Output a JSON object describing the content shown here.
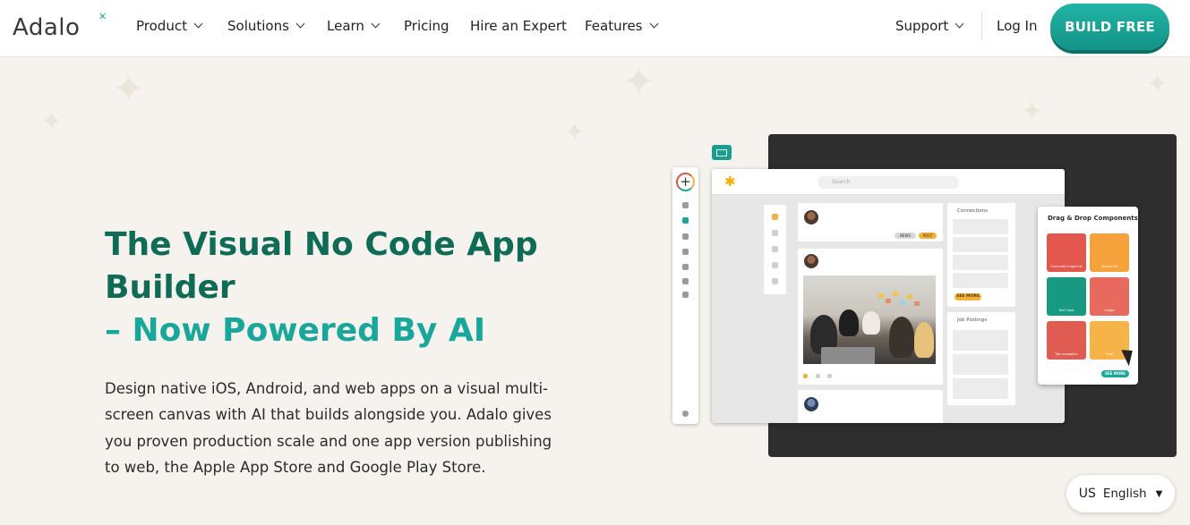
{
  "nav": {
    "logo": "Adalo",
    "items": [
      {
        "label": "Product",
        "dropdown": true
      },
      {
        "label": "Solutions",
        "dropdown": true
      },
      {
        "label": "Learn",
        "dropdown": true
      },
      {
        "label": "Pricing",
        "dropdown": false
      },
      {
        "label": "Hire an Expert",
        "dropdown": false
      },
      {
        "label": "Features",
        "dropdown": true
      }
    ],
    "support": "Support",
    "login": "Log In",
    "cta": "BUILD FREE"
  },
  "hero": {
    "headline_1": "The Visual No Code App Builder",
    "headline_2": "– Now Powered By AI",
    "description": "Design native iOS, Android, and web apps on a visual multi-screen canvas with AI that builds alongside you. Adalo gives you proven production scale and one app version publishing to web, the Apple App Store and Google Play Store."
  },
  "mockup": {
    "search_placeholder": "Search",
    "pill_gray": "NEWS",
    "pill_yellow": "POST",
    "connections_label": "Connections",
    "see_more": "SEE MORE",
    "job_postings_label": "Job Postings",
    "dnd_title": "Drag & Drop Components",
    "dnd_see_more": "SEE MORE",
    "components": [
      {
        "label": "Card with image list",
        "color": "#e4574e"
      },
      {
        "label": "Simple list",
        "color": "#f5a23a"
      },
      {
        "label": "Text input",
        "color": "#189a82"
      },
      {
        "label": "Image",
        "color": "#e86a5e"
      },
      {
        "label": "Tab navigation",
        "color": "#e05c52"
      },
      {
        "label": "Form",
        "color": "#f6b347"
      }
    ]
  },
  "language": {
    "code": "US",
    "label": "English",
    "caret": "▼"
  },
  "colors": {
    "brand_teal": "#1aa79b",
    "headline_green": "#0e6b55",
    "background": "#f6f3ee"
  }
}
